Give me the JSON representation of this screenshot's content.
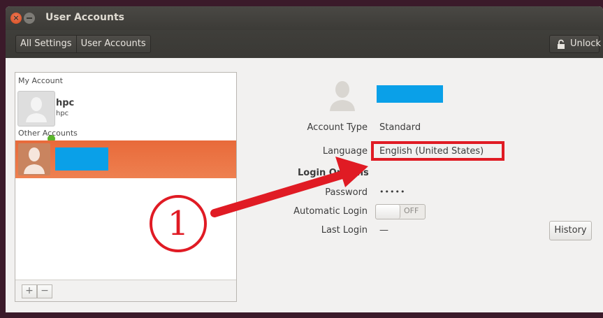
{
  "window": {
    "title": "User Accounts"
  },
  "toolbar": {
    "breadcrumbs": [
      "All Settings",
      "User Accounts"
    ],
    "unlock_label": "Unlock"
  },
  "accounts": {
    "my_account_header": "My Account",
    "current_user": {
      "name": "hpc",
      "login": "hpc"
    },
    "other_accounts_header": "Other Accounts",
    "add_label": "+",
    "remove_label": "−"
  },
  "details": {
    "account_type_label": "Account Type",
    "account_type_value": "Standard",
    "language_label": "Language",
    "language_value": "English (United States)",
    "login_options_title": "Login Options",
    "password_label": "Password",
    "password_value": "•••••",
    "auto_login_label": "Automatic Login",
    "auto_login_state": "OFF",
    "last_login_label": "Last Login",
    "last_login_value": "—",
    "history_label": "History"
  },
  "annotation": {
    "step_number": "1"
  },
  "colors": {
    "highlight": "#e01b24",
    "selection": "#e8693a",
    "redaction": "#0aa0e8"
  }
}
